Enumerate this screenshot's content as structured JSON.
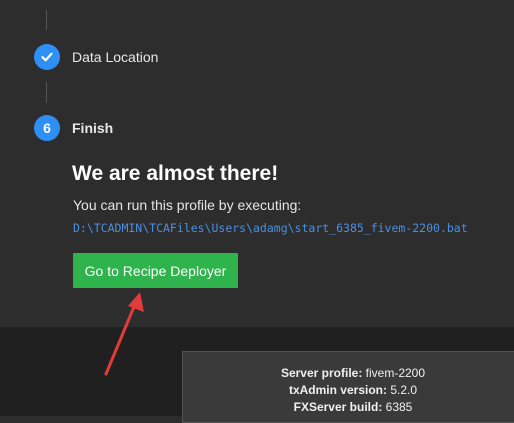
{
  "steps": [
    {
      "label": "Data Location",
      "state": "completed",
      "icon": "check-icon"
    },
    {
      "number": "6",
      "label": "Finish",
      "state": "active"
    }
  ],
  "finish": {
    "heading": "We are almost there!",
    "instructions": "You can run this profile by executing:",
    "path": "D:\\TCADMIN\\TCAFiles\\Users\\adamg\\start_6385_fivem-2200.bat",
    "button_label": "Go to Recipe Deployer"
  },
  "server_info": {
    "profile_label": "Server profile:",
    "profile_value": "fivem-2200",
    "txadmin_label": "txAdmin version:",
    "txadmin_value": "5.2.0",
    "fxserver_label": "FXServer build:",
    "fxserver_value": "6385"
  },
  "colors": {
    "accent": "#2e8ff5",
    "button": "#2fb34d",
    "annotation_arrow": "#e03c3c",
    "path_link": "#4a90e2"
  }
}
